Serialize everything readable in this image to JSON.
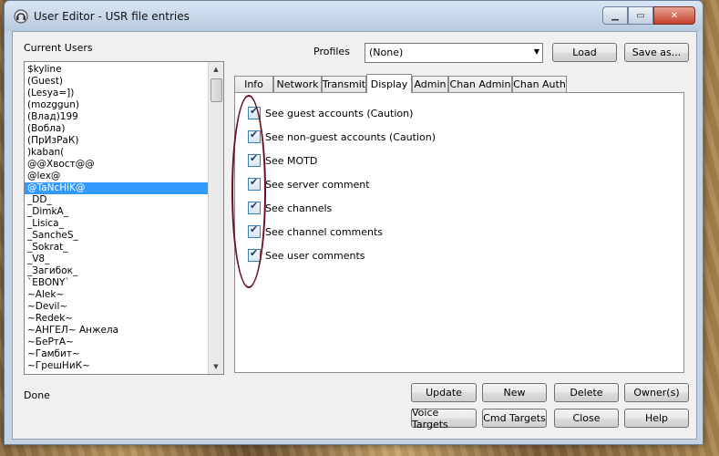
{
  "window": {
    "title": "User Editor - USR file entries",
    "close_glyph": "✕"
  },
  "left": {
    "label": "Current Users",
    "users": [
      "$kyline",
      "(Guest)",
      "(Lesya=])",
      "(mozggun)",
      "(Влад)199",
      "(Вобла)",
      "(ПрИзРаК)",
      ")kaban(",
      "@@Хвост@@",
      "@lex@",
      "@TaNcHiK@",
      "_DD_",
      "_DimkA_",
      "_Lisica_",
      "_SancheS_",
      "_Sokrat_",
      "_V8_",
      "_Загибок_",
      "`EBONY`",
      "~Alek~",
      "~Devil~",
      "~Redek~",
      "~АНГЕЛ~ Анжела",
      "~БеРтА~",
      "~Гамбит~",
      "~ГрешНиК~"
    ],
    "selected": "@TaNcHiK@"
  },
  "profiles": {
    "label": "Profiles",
    "value": "(None)",
    "load": "Load",
    "save_as": "Save as..."
  },
  "tabs": [
    "Info",
    "Network",
    "Transmit",
    "Display",
    "Admin",
    "Chan Admin",
    "Chan Auth"
  ],
  "active_tab": "Display",
  "display_options": [
    {
      "label": "See guest accounts (Caution)",
      "checked": true
    },
    {
      "label": "See non-guest accounts (Caution)",
      "checked": true
    },
    {
      "label": "See MOTD",
      "checked": true
    },
    {
      "label": "See server comment",
      "checked": true
    },
    {
      "label": "See channels",
      "checked": true
    },
    {
      "label": "See channel comments",
      "checked": true
    },
    {
      "label": "See user comments",
      "checked": true
    }
  ],
  "buttons": {
    "update": "Update",
    "new": "New",
    "delete": "Delete",
    "owners": "Owner(s)",
    "voice_targets": "Voice Targets",
    "cmd_targets": "Cmd Targets",
    "close": "Close",
    "help": "Help"
  },
  "status": "Done"
}
